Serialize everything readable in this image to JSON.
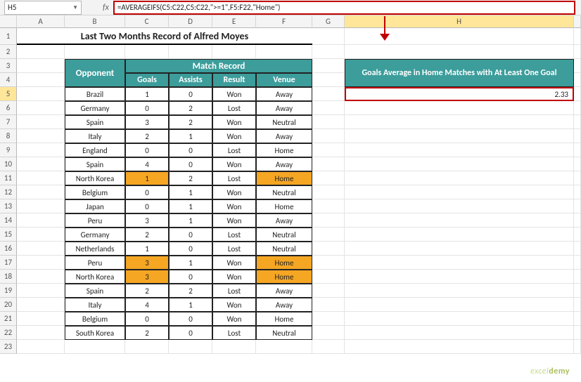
{
  "namebox": "H5",
  "formula": "=AVERAGEIFS(C5:C22,C5:C22,\">=1\",F5:F22,\"Home\")",
  "fx": "fx",
  "columns": [
    "",
    "A",
    "B",
    "C",
    "D",
    "E",
    "F",
    "G",
    "H",
    ""
  ],
  "title": "Last Two Months Record of Alfred Moyes",
  "table": {
    "opponent_h": "Opponent",
    "match_h": "Match Record",
    "sub_h": [
      "Goals",
      "Assists",
      "Result",
      "Venue"
    ],
    "rows": [
      {
        "opp": "Brazil",
        "g": "1",
        "a": "0",
        "r": "Won",
        "v": "Away"
      },
      {
        "opp": "Germany",
        "g": "0",
        "a": "2",
        "r": "Lost",
        "v": "Away"
      },
      {
        "opp": "Spain",
        "g": "3",
        "a": "2",
        "r": "Won",
        "v": "Neutral"
      },
      {
        "opp": "Italy",
        "g": "2",
        "a": "1",
        "r": "Won",
        "v": "Away"
      },
      {
        "opp": "England",
        "g": "0",
        "a": "0",
        "r": "Lost",
        "v": "Home"
      },
      {
        "opp": "Spain",
        "g": "4",
        "a": "0",
        "r": "Won",
        "v": "Away"
      },
      {
        "opp": "North Korea",
        "g": "1",
        "a": "2",
        "r": "Lost",
        "v": "Home",
        "hl": true
      },
      {
        "opp": "Belgium",
        "g": "0",
        "a": "1",
        "r": "Won",
        "v": "Neutral"
      },
      {
        "opp": "Japan",
        "g": "0",
        "a": "1",
        "r": "Won",
        "v": "Home"
      },
      {
        "opp": "Peru",
        "g": "3",
        "a": "1",
        "r": "Won",
        "v": "Away"
      },
      {
        "opp": "Germany",
        "g": "2",
        "a": "0",
        "r": "Lost",
        "v": "Neutral"
      },
      {
        "opp": "Netherlands",
        "g": "1",
        "a": "0",
        "r": "Lost",
        "v": "Neutral"
      },
      {
        "opp": "Peru",
        "g": "3",
        "a": "1",
        "r": "Won",
        "v": "Home",
        "hl": true
      },
      {
        "opp": "North Korea",
        "g": "3",
        "a": "0",
        "r": "Won",
        "v": "Home",
        "hl": true
      },
      {
        "opp": "Spain",
        "g": "2",
        "a": "2",
        "r": "Lost",
        "v": "Away"
      },
      {
        "opp": "Italy",
        "g": "4",
        "a": "1",
        "r": "Won",
        "v": "Away"
      },
      {
        "opp": "Belgium",
        "g": "0",
        "a": "0",
        "r": "Won",
        "v": "Home"
      },
      {
        "opp": "South Korea",
        "g": "2",
        "a": "0",
        "r": "Lost",
        "v": "Neutral"
      }
    ]
  },
  "side": {
    "header": "Goals Average in Home Matches with At Least One Goal",
    "value": "2.33"
  },
  "watermark_a": "excel",
  "watermark_b": "demy"
}
